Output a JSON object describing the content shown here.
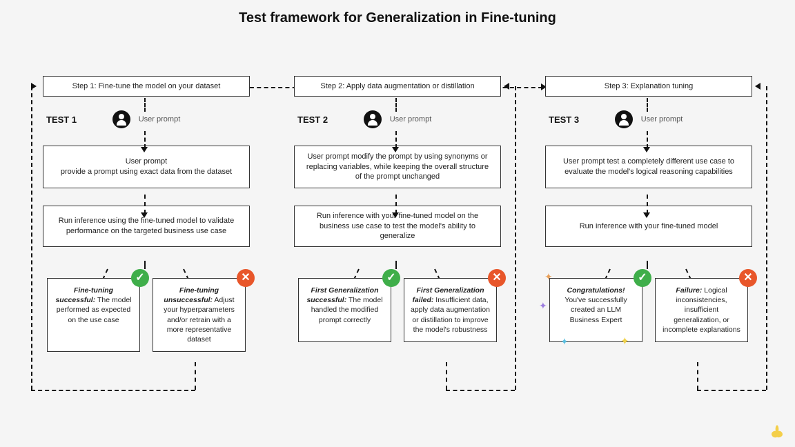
{
  "title": "Test framework for Generalization in Fine-tuning",
  "user_prompt_label": "User prompt",
  "columns": [
    {
      "step_header": "Step 1: Fine-tune the model on your dataset",
      "test_label": "TEST 1",
      "prompt_text": "User prompt\nprovide a prompt using exact data from the dataset",
      "inference_text": "Run inference using the fine-tuned model to validate performance on the targeted business use case",
      "success_title": "Fine-tuning successful:",
      "success_body": "The model performed as expected on the use case",
      "failure_title": "Fine-tuning unsuccessful:",
      "failure_body": "Adjust your hyperparameters and/or retrain with a more representative dataset"
    },
    {
      "step_header": "Step 2: Apply data augmentation or distillation",
      "test_label": "TEST 2",
      "prompt_text": "User prompt modify the prompt by using synonyms or replacing variables, while keeping the overall structure of the prompt unchanged",
      "inference_text": "Run inference with your fine-tuned model on the business use case to test the model's ability to generalize",
      "success_title": "First Generalization successful:",
      "success_body": "The model handled the modified prompt correctly",
      "failure_title": "First Generalization failed:",
      "failure_body": "Insufficient data, apply data augmentation or distillation to improve the model's robustness"
    },
    {
      "step_header": "Step 3: Explanation tuning",
      "test_label": "TEST 3",
      "prompt_text": "User prompt test a completely different use case to evaluate the model's logical reasoning capabilities",
      "inference_text": "Run inference with your fine-tuned model",
      "success_title": "Congratulations!",
      "success_body": "You've successfully created an LLM Business Expert",
      "failure_title": "Failure:",
      "failure_body": "Logical inconsistencies, insufficient generalization, or incomplete explanations"
    }
  ]
}
